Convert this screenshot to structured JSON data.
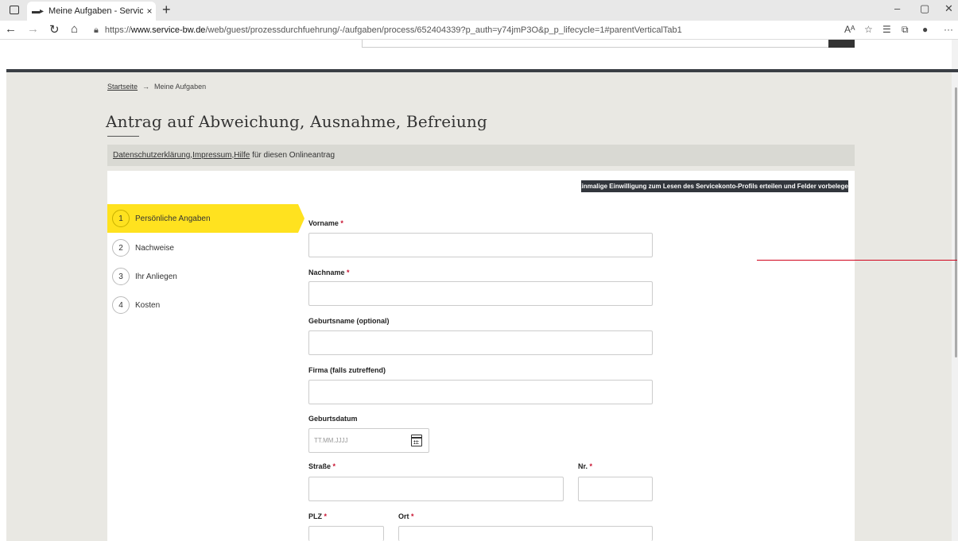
{
  "browser": {
    "tab_title": "Meine Aufgaben - Serviceportal",
    "tab_close": "×",
    "new_tab": "+",
    "url_prefix": "https://",
    "url_domain": "www.service-bw.de",
    "url_path": "/web/guest/prozessdurchfuehrung/-/aufgaben/process/652404339?p_auth=y74jmP3O&p_p_lifecycle=1#parentVerticalTab1"
  },
  "breadcrumb": {
    "home": "Startseite",
    "separator": "→",
    "current": "Meine Aufgaben"
  },
  "page": {
    "title": "Antrag auf Abweichung, Ausnahme, Befreiung"
  },
  "infobar": {
    "privacy": "Datenschutzerklärung",
    "sep1": ", ",
    "imprint": "Impressum",
    "sep2": ", ",
    "help": "Hilfe",
    "suffix": " für diesen Onlineantrag"
  },
  "consent_button": "Einmalige Einwilligung zum Lesen des Servicekonto-Profils erteilen und Felder vorbelegen",
  "steps": [
    {
      "num": "1",
      "label": "Persönliche Angaben"
    },
    {
      "num": "2",
      "label": "Nachweise"
    },
    {
      "num": "3",
      "label": "Ihr Anliegen"
    },
    {
      "num": "4",
      "label": "Kosten"
    }
  ],
  "form": {
    "required_mark": "*",
    "vorname": "Vorname",
    "nachname": "Nachname",
    "geburtsname": "Geburtsname (optional)",
    "firma": "Firma (falls zutreffend)",
    "geburtsdatum": "Geburtsdatum",
    "geburtsdatum_placeholder": "TT.MM.JJJJ",
    "strasse": "Straße",
    "nr": "Nr.",
    "plz": "PLZ",
    "ort": "Ort"
  },
  "colors": {
    "accent_yellow": "#ffe21f",
    "required_red": "#c8102e",
    "dark_button": "#32363c",
    "background": "#e9e8e3"
  }
}
